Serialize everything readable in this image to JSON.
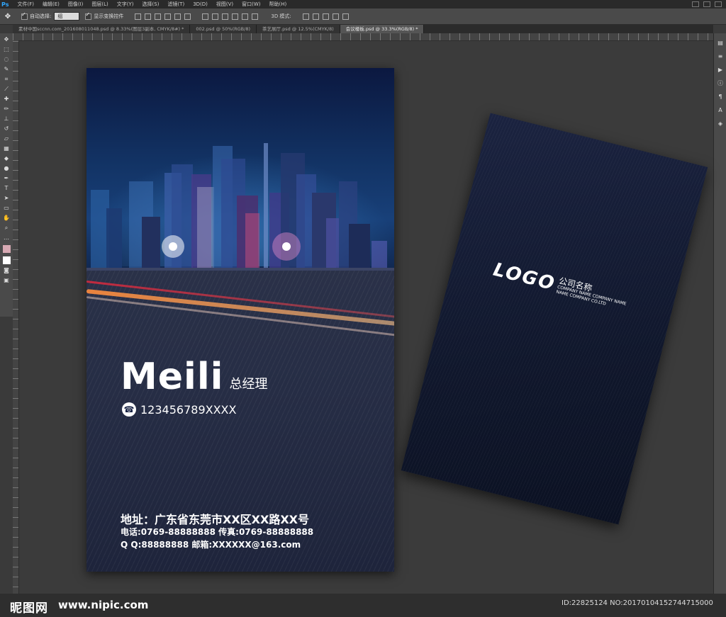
{
  "menubar": {
    "logo": "Ps",
    "items": [
      "文件(F)",
      "编辑(E)",
      "图像(I)",
      "图层(L)",
      "文字(Y)",
      "选择(S)",
      "滤镜(T)",
      "3D(D)",
      "视图(V)",
      "窗口(W)",
      "帮助(H)"
    ]
  },
  "options": {
    "auto_select_label": "自动选择:",
    "auto_select_value": "组",
    "show_transform_label": "显示变换控件",
    "mode_3d_label": "3D 模式:"
  },
  "tabs": [
    {
      "label": "素材中国sccnn.com_201608011048.psd @ 8.33%(图层3副本, CMYK/8#) *"
    },
    {
      "label": "002.psd @ 50%(RGB/8)"
    },
    {
      "label": "茶艺展厅.psd @ 12.5%(CMYK/8)"
    },
    {
      "label": "会议楼板.psd @ 33.3%(RGB/8) *"
    }
  ],
  "front_card": {
    "name": "Meili",
    "title": "总经理",
    "phone": "123456789XXXX",
    "address": "地址：广东省东莞市XX区XX路XX号",
    "tel_fax": "电话:0769-88888888  传真:0769-88888888",
    "qq_email": "Q Q:88888888  邮箱:XXXXXX@163.com"
  },
  "back_card": {
    "logo": "LOGO",
    "company_name": "公司名称",
    "company_en_1": "COMPANY NAME COMPANY NAME",
    "company_en_2": "NAME COMPANY CO.LTD"
  },
  "watermark": {
    "logo": "昵图网",
    "url": "www.nipic.com",
    "id": "ID:22825124 NO:20170104152744715000"
  },
  "colors": {
    "accent_ps": "#31a8ff",
    "trail_orange": "#ff7a2a",
    "trail_red": "#e0283a"
  }
}
